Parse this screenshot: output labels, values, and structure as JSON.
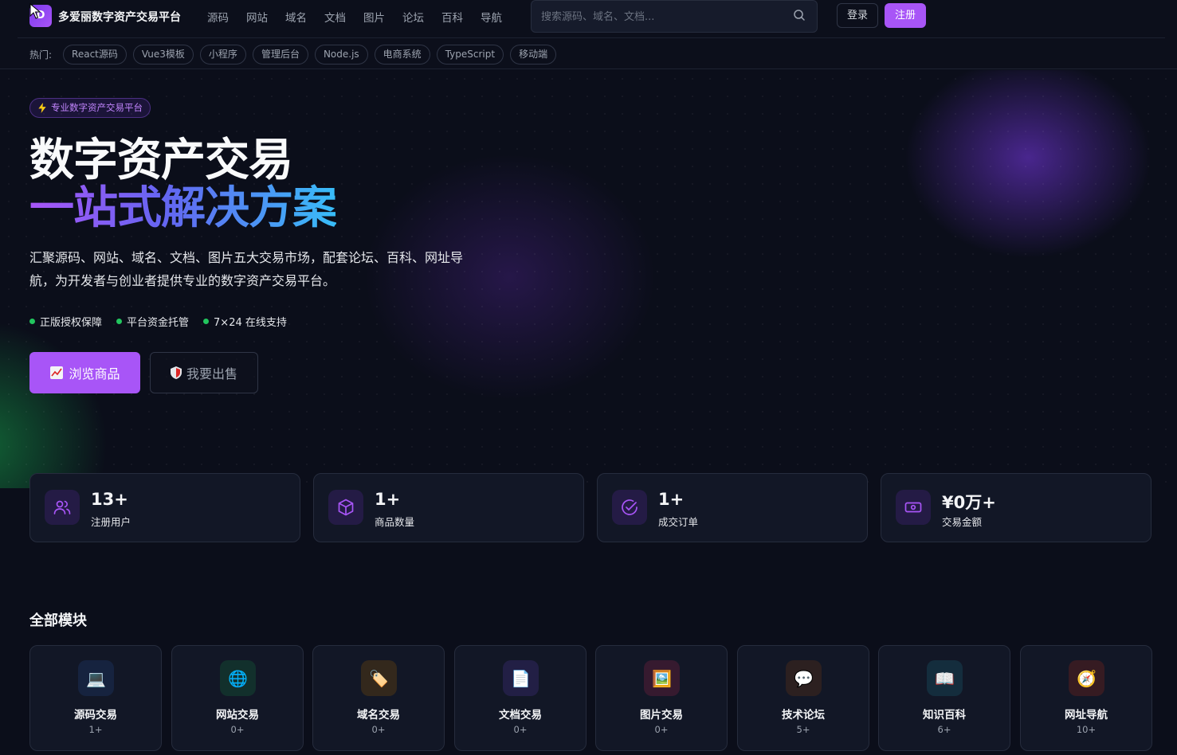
{
  "header": {
    "logo_text": "D",
    "brand": "多爱丽数字资产交易平台",
    "nav": [
      "源码",
      "网站",
      "域名",
      "文档",
      "图片",
      "论坛",
      "百科",
      "导航"
    ],
    "search_placeholder": "搜索源码、域名、文档...",
    "login": "登录",
    "register": "注册",
    "hot_label": "热门:",
    "hot_tags": [
      "React源码",
      "Vue3模板",
      "小程序",
      "管理后台",
      "Node.js",
      "电商系统",
      "TypeScript",
      "移动端"
    ]
  },
  "hero": {
    "badge": "专业数字资产交易平台",
    "title_line1": "数字资产交易",
    "title_line2": "一站式解决方案",
    "description": "汇聚源码、网站、域名、文档、图片五大交易市场，配套论坛、百科、网址导航，为开发者与创业者提供专业的数字资产交易平台。",
    "features": [
      "正版授权保障",
      "平台资金托管",
      "7×24 在线支持"
    ],
    "browse_button": "浏览商品",
    "sell_button": "我要出售"
  },
  "stats": [
    {
      "icon": "users-icon",
      "value": "13+",
      "label": "注册用户"
    },
    {
      "icon": "box-icon",
      "value": "1+",
      "label": "商品数量"
    },
    {
      "icon": "check-circle-icon",
      "value": "1+",
      "label": "成交订单"
    },
    {
      "icon": "money-icon",
      "value": "¥0万+",
      "label": "交易金额"
    }
  ],
  "modules": {
    "title": "全部模块",
    "items": [
      {
        "icon": "laptop-icon",
        "glyph": "💻",
        "name": "源码交易",
        "count": "1+",
        "bg": "#16233f"
      },
      {
        "icon": "globe-icon",
        "glyph": "🌐",
        "name": "网站交易",
        "count": "0+",
        "bg": "#12302c"
      },
      {
        "icon": "tag-icon",
        "glyph": "🏷️",
        "name": "域名交易",
        "count": "0+",
        "bg": "#33281c"
      },
      {
        "icon": "document-icon",
        "glyph": "📄",
        "name": "文档交易",
        "count": "0+",
        "bg": "#221f45"
      },
      {
        "icon": "picture-icon",
        "glyph": "🖼️",
        "name": "图片交易",
        "count": "0+",
        "bg": "#361a2f"
      },
      {
        "icon": "chat-icon",
        "glyph": "💬",
        "name": "技术论坛",
        "count": "5+",
        "bg": "#2c2020"
      },
      {
        "icon": "book-icon",
        "glyph": "📖",
        "name": "知识百科",
        "count": "6+",
        "bg": "#142d3d"
      },
      {
        "icon": "compass-icon",
        "glyph": "🧭",
        "name": "网址导航",
        "count": "10+",
        "bg": "#361b22"
      }
    ]
  }
}
